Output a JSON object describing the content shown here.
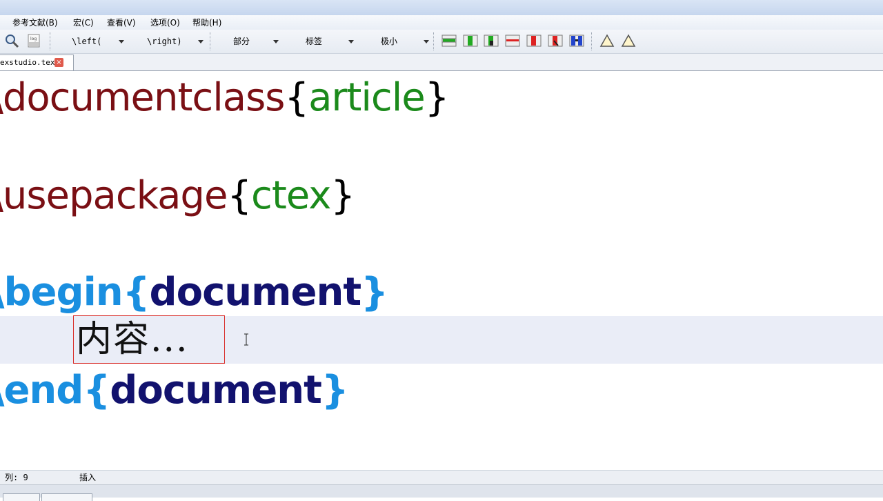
{
  "menu": {
    "items": [
      "参考文献(B)",
      "宏(C)",
      "查看(V)",
      "选项(O)",
      "帮助(H)"
    ]
  },
  "toolbar": {
    "left_delim": "\\left(",
    "right_delim": "\\right)",
    "section": "部分",
    "label": "标签",
    "size": "极小",
    "icons": [
      "search-icon",
      "log-icon",
      "table-icons",
      "warning-icon"
    ]
  },
  "tabs": {
    "active": "exstudio.tex",
    "close_symbol": "×"
  },
  "editor": {
    "line1": {
      "cmd": "\\documentclass",
      "open": "{",
      "arg": "article",
      "close": "}"
    },
    "line2": {
      "cmd": "\\usepackage",
      "open": "{",
      "arg": "ctex",
      "close": "}"
    },
    "line3": {
      "cmd": "\\begin",
      "open": "{",
      "arg": "document",
      "close": "}"
    },
    "line4": {
      "text": "内容..."
    },
    "line5": {
      "cmd": "\\end",
      "open": "{",
      "arg": "document",
      "close": "}"
    }
  },
  "status": {
    "column": "列: 9",
    "mode": "插入"
  },
  "colors": {
    "command_red": "#7a0f14",
    "command_blue": "#1a8fe0",
    "arg_green": "#1b8a1b",
    "arg_navy": "#12126e",
    "current_line": "#eaedf7",
    "highlight_border": "#d9302c"
  }
}
